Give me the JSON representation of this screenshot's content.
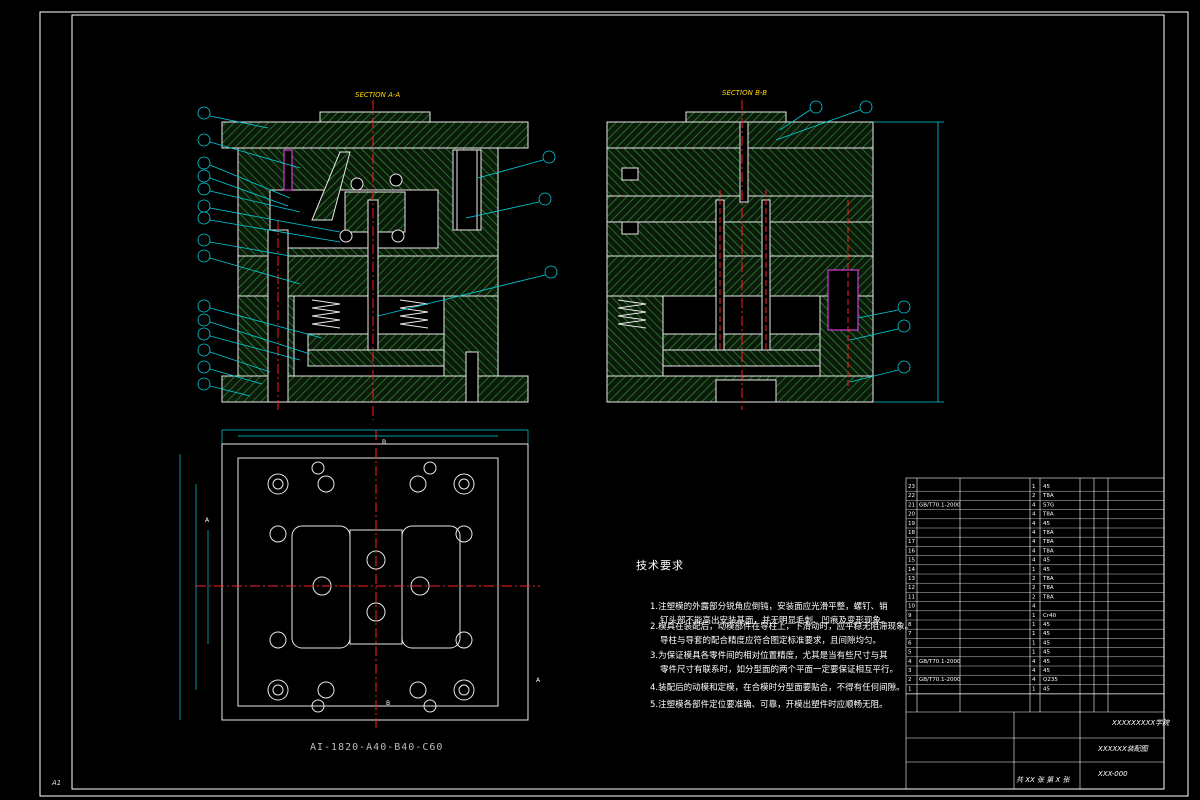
{
  "sections": {
    "a": "SECTION A-A",
    "b": "SECTION B-B"
  },
  "tech_requirements": {
    "title": "技术要求",
    "items": [
      "1.注塑模的外露部分锐角应倒钝，安装面应光滑平整，螺钉、销",
      "钉头部不能高出安装基面，并无明显毛刺、凹痕及变形现象。",
      "2.模具在装配后，动模部件在导柱上，下滑动时，应平稳无阻滞现象。",
      "导柱与导套的配合精度应符合图定标准要求，且间隙均匀。",
      "3.为保证模具各零件间的相对位置精度，尤其是当有些尺寸与其",
      "零件尺寸有联系时，如分型面的两个平面一定要保证相互平行。",
      "4.装配后的动模和定模，在合模时分型面要贴合，不得有任何间隙。",
      "5.注塑模各部件定位要准确、可靠，开模出塑件时应顺畅无阻。"
    ]
  },
  "model_code": "AI-1820-A40-B40-C60",
  "corner_label": "A1",
  "title_block": {
    "school": "XXXXXXXXX学院",
    "drawing_name": "XXXXXX装配图",
    "drawing_no": "XXX-000",
    "sheet": "共 XX 张  第 X 张"
  },
  "parts_list": [
    {
      "no": "23",
      "std": "",
      "qty": "1",
      "mat": "45"
    },
    {
      "no": "22",
      "std": "",
      "qty": "2",
      "mat": "T8A"
    },
    {
      "no": "21",
      "std": "GB/T70.1-2000",
      "qty": "4",
      "mat": "S7G"
    },
    {
      "no": "20",
      "std": "",
      "qty": "4",
      "mat": "T8A"
    },
    {
      "no": "19",
      "std": "",
      "qty": "4",
      "mat": "45"
    },
    {
      "no": "18",
      "std": "",
      "qty": "4",
      "mat": "T8A"
    },
    {
      "no": "17",
      "std": "",
      "qty": "4",
      "mat": "T8A"
    },
    {
      "no": "16",
      "std": "",
      "qty": "4",
      "mat": "T8A"
    },
    {
      "no": "15",
      "std": "",
      "qty": "4",
      "mat": "45"
    },
    {
      "no": "14",
      "std": "",
      "qty": "1",
      "mat": "45"
    },
    {
      "no": "13",
      "std": "",
      "qty": "2",
      "mat": "T8A"
    },
    {
      "no": "12",
      "std": "",
      "qty": "2",
      "mat": "T8A"
    },
    {
      "no": "11",
      "std": "",
      "qty": "2",
      "mat": "T8A"
    },
    {
      "no": "10",
      "std": "",
      "qty": "4",
      "mat": ""
    },
    {
      "no": "9",
      "std": "",
      "qty": "1",
      "mat": "Cr40"
    },
    {
      "no": "8",
      "std": "",
      "qty": "1",
      "mat": "45"
    },
    {
      "no": "7",
      "std": "",
      "qty": "1",
      "mat": "45"
    },
    {
      "no": "6",
      "std": "",
      "qty": "1",
      "mat": "45"
    },
    {
      "no": "5",
      "std": "",
      "qty": "1",
      "mat": "45"
    },
    {
      "no": "4",
      "std": "GB/T70.1-2000",
      "qty": "4",
      "mat": "45"
    },
    {
      "no": "3",
      "std": "",
      "qty": "4",
      "mat": "45"
    },
    {
      "no": "2",
      "std": "GB/T70.1-2000",
      "qty": "4",
      "mat": "Q235"
    },
    {
      "no": "1",
      "std": "",
      "qty": "1",
      "mat": "45"
    }
  ],
  "colors": {
    "background": "#000000",
    "frame": "#ffffff",
    "hatch": "#2f9a2f",
    "outline": "#e8e8e8",
    "centerline": "#ff2020",
    "leader": "#00d0e0",
    "section_label": "#ffd800",
    "dimension": "#00d0e0",
    "pin_highlight": "#ff40ff"
  }
}
